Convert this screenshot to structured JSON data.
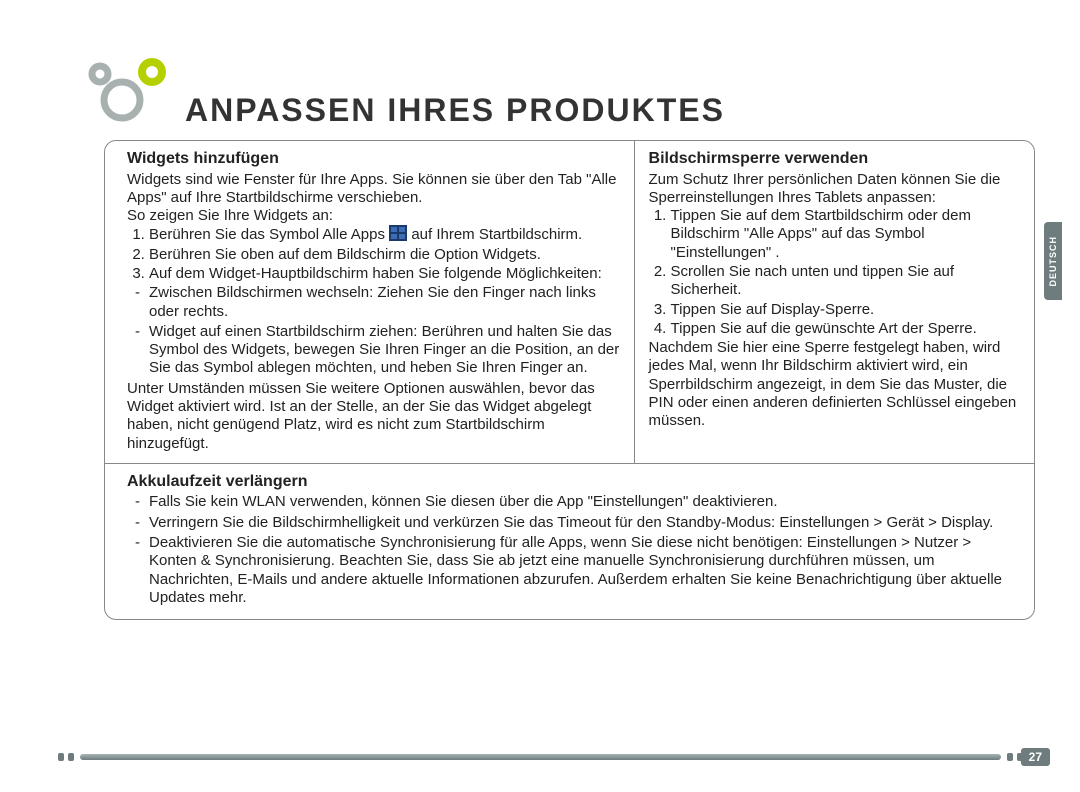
{
  "language_tab": "DEUTSCH",
  "title": "ANPASSEN IHRES PRODUKTES",
  "page_number": "27",
  "widgets": {
    "heading": "Widgets hinzufügen",
    "intro": "Widgets sind wie Fenster für Ihre Apps. Sie können sie über den Tab \"Alle Apps\" auf Ihre Startbildschirme verschieben.\nSo zeigen Sie Ihre Widgets an:",
    "step1_pre": "Berühren Sie das Symbol Alle Apps ",
    "step1_post": " auf Ihrem Startbildschirm.",
    "step2": "Berühren Sie oben auf dem Bildschirm die Option Widgets.",
    "step3": "Auf dem Widget-Hauptbildschirm haben Sie folgende Möglichkeiten:",
    "dash1": "Zwischen Bildschirmen wechseln: Ziehen Sie den Finger nach links oder rechts.",
    "dash2": "Widget auf einen Startbildschirm ziehen: Berühren und halten Sie das Symbol des Widgets, bewegen Sie Ihren Finger an die Position, an der Sie das Symbol ablegen möchten, und heben Sie Ihren Finger an.",
    "outro": "Unter Umständen müssen Sie weitere Optionen auswählen, bevor das Widget aktiviert wird. Ist an der Stelle, an der Sie das Widget abgelegt haben, nicht genügend Platz, wird es nicht zum Startbildschirm hinzugefügt."
  },
  "lock": {
    "heading": "Bildschirmsperre verwenden",
    "intro": "Zum Schutz Ihrer persönlichen Daten können Sie die Sperreinstellungen Ihres Tablets anpassen:",
    "step1": "Tippen Sie auf dem Startbildschirm oder dem Bildschirm \"Alle Apps\" auf das Symbol \"Einstellungen\" .",
    "step2": "Scrollen Sie nach unten und tippen Sie auf Sicherheit.",
    "step3": "Tippen Sie auf Display-Sperre.",
    "step4": "Tippen Sie auf die gewünschte Art der Sperre.",
    "outro": "Nachdem Sie hier eine Sperre festgelegt haben, wird jedes Mal, wenn Ihr Bildschirm aktiviert wird, ein Sperrbildschirm angezeigt, in dem Sie das Muster, die PIN oder einen anderen definierten Schlüssel eingeben müssen."
  },
  "battery": {
    "heading": "Akkulaufzeit verlängern",
    "d1": "Falls Sie kein WLAN verwenden, können Sie diesen über die App \"Einstellungen\" deaktivieren.",
    "d2": "Verringern Sie die Bildschirmhelligkeit und verkürzen Sie das Timeout für den Standby-Modus: Einstellungen > Gerät > Display.",
    "d3": "Deaktivieren Sie die automatische Synchronisierung für alle Apps, wenn Sie diese nicht benötigen: Einstellungen > Nutzer > Konten & Synchronisierung. Beachten Sie, dass Sie ab jetzt eine manuelle Synchronisierung durchführen müssen, um Nachrichten, E-Mails und andere aktuelle Informationen abzurufen. Außerdem erhalten Sie keine Benachrichtigung über aktuelle Updates mehr."
  }
}
